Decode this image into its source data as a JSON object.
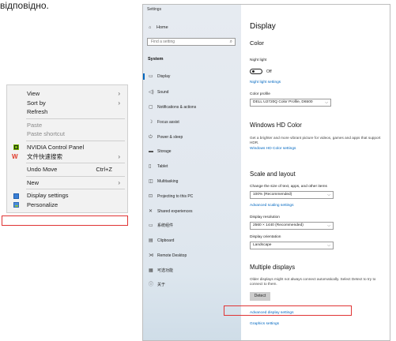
{
  "page_top_text": "відповідно.",
  "context_menu": {
    "items": [
      {
        "label": "View",
        "arrow": "›"
      },
      {
        "label": "Sort by",
        "arrow": "›"
      },
      {
        "label": "Refresh"
      },
      {
        "label": "Paste"
      },
      {
        "label": "Paste shortcut"
      },
      {
        "label": "NVIDIA Control Panel"
      },
      {
        "label": "文件快速搜索",
        "arrow": "›"
      },
      {
        "label": "Undo Move",
        "shortcut": "Ctrl+Z"
      },
      {
        "label": "New",
        "arrow": "›"
      },
      {
        "label": "Display settings"
      },
      {
        "label": "Personalize"
      }
    ],
    "wps_glyph": "W",
    "highlight_color": "#e03434"
  },
  "settings": {
    "window_title": "Settings",
    "home_label": "Home",
    "search_placeholder": "Find a setting",
    "section_label": "System",
    "nav_items": [
      {
        "label": "Display",
        "icon": "monitor-icon",
        "glyph": "▭"
      },
      {
        "label": "Sound",
        "icon": "speaker-icon",
        "glyph": "◁)"
      },
      {
        "label": "Notifications & actions",
        "icon": "notification-icon",
        "glyph": "▢"
      },
      {
        "label": "Focus assist",
        "icon": "moon-icon",
        "glyph": "☽"
      },
      {
        "label": "Power & sleep",
        "icon": "power-icon",
        "glyph": "⏻"
      },
      {
        "label": "Storage",
        "icon": "storage-icon",
        "glyph": "▬"
      },
      {
        "label": "Tablet",
        "icon": "tablet-icon",
        "glyph": "▯"
      },
      {
        "label": "Multitasking",
        "icon": "multitask-icon",
        "glyph": "◫"
      },
      {
        "label": "Projecting to this PC",
        "icon": "projector-icon",
        "glyph": "⊡"
      },
      {
        "label": "Shared experiences",
        "icon": "share-icon",
        "glyph": "✕"
      },
      {
        "label": "系统组件",
        "icon": "components-icon",
        "glyph": "▭"
      },
      {
        "label": "Clipboard",
        "icon": "clipboard-icon",
        "glyph": "▤"
      },
      {
        "label": "Remote Desktop",
        "icon": "remote-icon",
        "glyph": "⋊"
      },
      {
        "label": "可选功能",
        "icon": "optional-features-icon",
        "glyph": "▦"
      },
      {
        "label": "关于",
        "icon": "info-icon",
        "glyph": "ⓘ"
      }
    ],
    "content": {
      "title": "Display",
      "color_heading": "Color",
      "night_light_label": "Night light",
      "night_light_state": "Off",
      "night_light_settings_link": "Night light settings",
      "color_profile_label": "Color profile",
      "color_profile_value": "DELL U2720Q Color Profile, D6500",
      "hdr_heading": "Windows HD Color",
      "hdr_description": "Get a brighter and more vibrant picture for videos, games and apps that support HDR.",
      "hdr_link": "Windows HD Color settings",
      "scale_heading": "Scale and layout",
      "scale_label": "Change the size of text, apps, and other items",
      "scale_value": "100% (Recommended)",
      "advanced_scaling_link": "Advanced scaling settings",
      "resolution_label": "Display resolution",
      "resolution_value": "2560 × 1440 (Recommended)",
      "orientation_label": "Display orientation",
      "orientation_value": "Landscape",
      "multiple_heading": "Multiple displays",
      "multiple_description": "Older displays might not always connect automatically. Select Detect to try to connect to them.",
      "detect_button": "Detect",
      "advanced_display_link": "Advanced display settings",
      "graphics_link": "Graphics settings"
    },
    "accent_color": "#0067c0"
  }
}
